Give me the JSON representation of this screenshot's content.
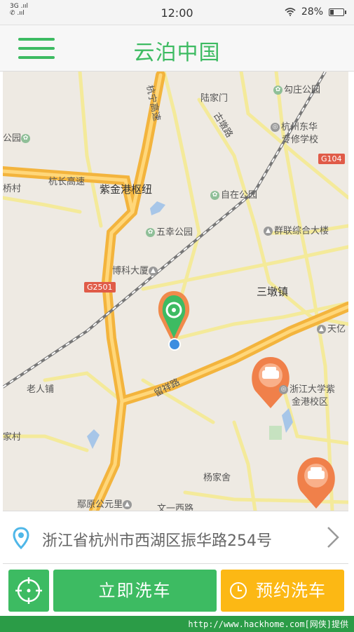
{
  "status_bar": {
    "network_top": "3G",
    "signal_icon": "signal-bars-icon",
    "call_icon": "phone-signal-icon",
    "time": "12:00",
    "wifi_icon": "wifi-icon",
    "battery": "28%",
    "battery_level": 0.28
  },
  "header": {
    "menu_icon": "hamburger-menu-icon",
    "title": "云泊中国"
  },
  "map": {
    "labels": {
      "gouzhuang_park": "勾庄公园",
      "lujiamen": "陆家门",
      "gudang_road": "古墩路",
      "hangzhou_donghua": "杭州东华",
      "zhuanxiu_school": "专修学校",
      "g104": "G104",
      "park_left": "公园",
      "hangchang_highway": "杭长高速",
      "zijingang_hub": "紫金港枢纽",
      "zizai_park": "自在公园",
      "hangning_highway": "杭宁高速",
      "qiao_cun": "桥村",
      "wuxing_park": "五幸公园",
      "qunlian_building": "群联综合大楼",
      "boke_building": "博科大厦",
      "g2501": "G2501",
      "sandun_town": "三墩镇",
      "tianji": "天亿",
      "laoren_pu": "老人铺",
      "liuxiang_road": "留祥路",
      "zju_zijingang": "浙江大学紫",
      "zju_campus": "金港校区",
      "jiacun": "家村",
      "yangjiashe": "杨家舍",
      "yuanyuan_gongli": "鄢原公元里",
      "wenyi_west_road": "文一西路"
    },
    "current_location_marker": "location-pin-icon",
    "car_markers": [
      "car-marker-icon",
      "car-marker-icon"
    ]
  },
  "address_bar": {
    "pin_icon": "location-pin-icon",
    "text": "浙江省杭州市西湖区振华路254号",
    "chevron_icon": "chevron-right-icon"
  },
  "actions": {
    "locate_icon": "crosshair-icon",
    "wash_now": "立即洗车",
    "reserve_icon": "clock-icon",
    "reserve_wash": "预约洗车"
  },
  "footer": {
    "watermark": "http://www.hackhome.com[网侠]提供"
  },
  "colors": {
    "brand_green": "#3dbb62",
    "accent_orange": "#fcb814",
    "car_marker": "#f0804a"
  }
}
